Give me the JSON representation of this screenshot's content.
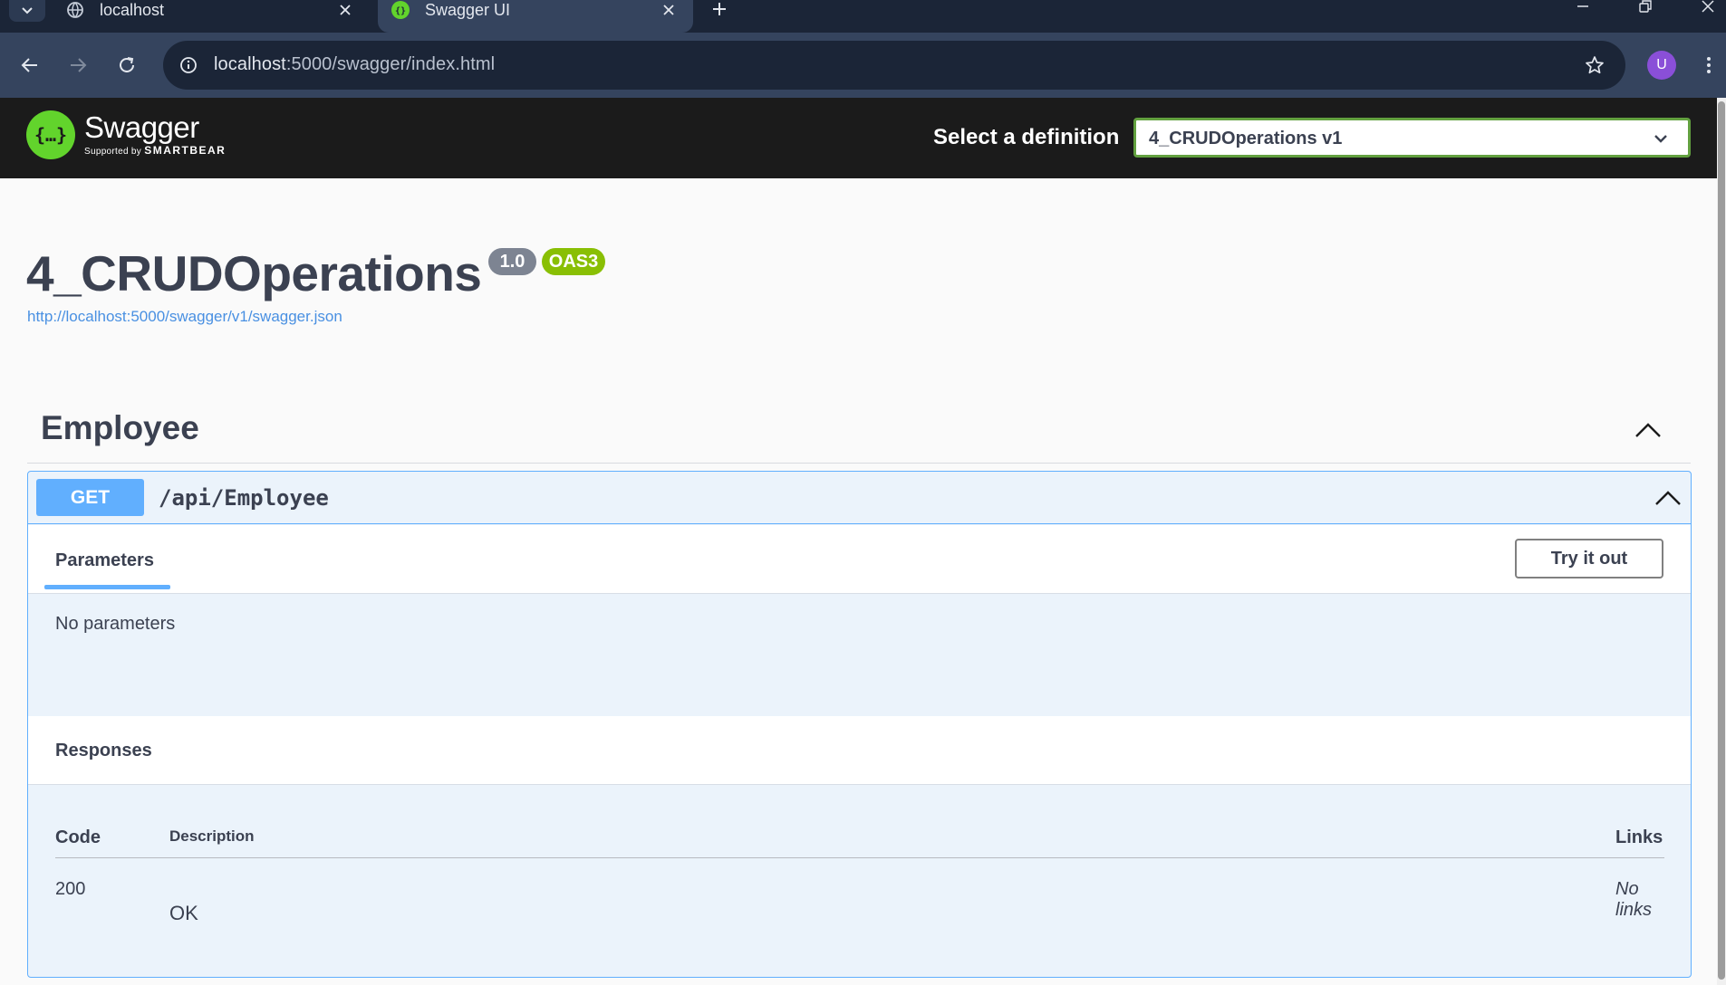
{
  "browser": {
    "tabs": [
      {
        "title": "localhost",
        "active": false
      },
      {
        "title": "Swagger UI",
        "active": true
      }
    ],
    "address": {
      "host": "localhost",
      "path": ":5000/swagger/index.html"
    },
    "profile_initial": "U",
    "icons": [
      "tab-search-icon",
      "globe-icon",
      "swagger-favicon",
      "close-icon",
      "plus-icon",
      "minimize-icon",
      "restore-icon",
      "window-close-icon",
      "back-arrow-icon",
      "forward-arrow-icon",
      "reload-icon",
      "info-icon",
      "bookmark-star-icon",
      "kebab-menu-icon"
    ]
  },
  "topbar": {
    "logo_name": "Swagger",
    "logo_sub_prefix": "Supported by",
    "logo_sub_brand": "SMARTBEAR",
    "select_label": "Select a definition",
    "select_value": "4_CRUDOperations v1",
    "accent": "#62d42c"
  },
  "info": {
    "title": "4_CRUDOperations",
    "version": "1.0",
    "oas": "OAS3",
    "spec_url": "http://localhost:5000/swagger/v1/swagger.json"
  },
  "tag": {
    "name": "Employee",
    "operation": {
      "method": "GET",
      "path": "/api/Employee",
      "method_color": "#61affe",
      "parameters_tab": "Parameters",
      "try_button": "Try it out",
      "no_params": "No parameters",
      "responses_title": "Responses",
      "table": {
        "headers": {
          "code": "Code",
          "description": "Description",
          "links": "Links"
        },
        "rows": [
          {
            "code": "200",
            "description": "OK",
            "links": "No links"
          }
        ]
      }
    }
  }
}
